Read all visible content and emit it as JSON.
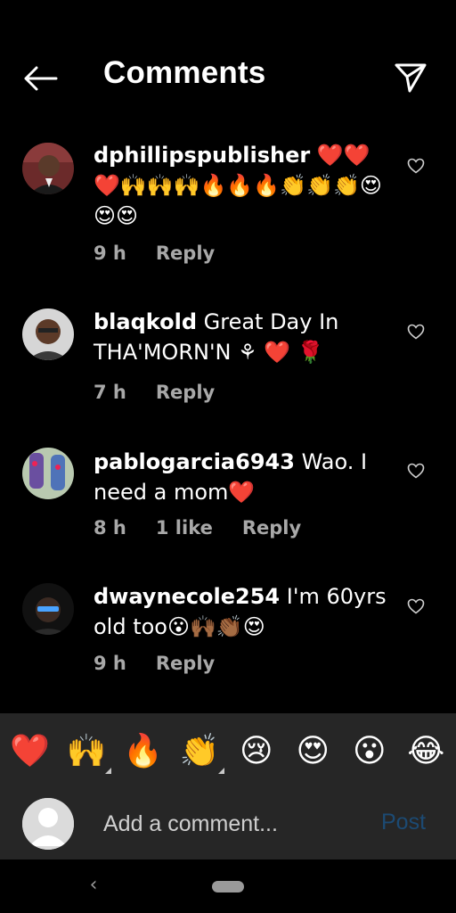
{
  "header": {
    "title": "Comments",
    "back_icon": "arrow-left-icon",
    "share_icon": "paper-plane-icon"
  },
  "comments": [
    {
      "username": "dphillipspublisher",
      "text": " ❤️❤️❤️🙌🙌🙌🔥🔥🔥👏👏👏😍😍😍",
      "time": "9 h",
      "likes": "",
      "reply_label": "Reply"
    },
    {
      "username": "blaqkold",
      "text": " Great Day In THA'MORN'N ⚘ ❤️ 🌹",
      "time": "7 h",
      "likes": "",
      "reply_label": "Reply"
    },
    {
      "username": "pablogarcia6943",
      "text": " Wao. I need a mom❤️",
      "time": "8 h",
      "likes": "1 like",
      "reply_label": "Reply"
    },
    {
      "username": "dwaynecole254",
      "text": " I'm 60yrs old too😮🙌🏾👏🏾😍",
      "time": "9 h",
      "likes": "",
      "reply_label": "Reply"
    }
  ],
  "emoji_bar": [
    "❤️",
    "🙌",
    "🔥",
    "👏",
    "😢",
    "😍",
    "😮",
    "😂"
  ],
  "composer": {
    "placeholder": "Add a comment...",
    "post_label": "Post"
  },
  "colors": {
    "background": "#000000",
    "panel": "#262626",
    "meta_text": "#a8a8a8",
    "post_disabled": "#1c4a73"
  }
}
